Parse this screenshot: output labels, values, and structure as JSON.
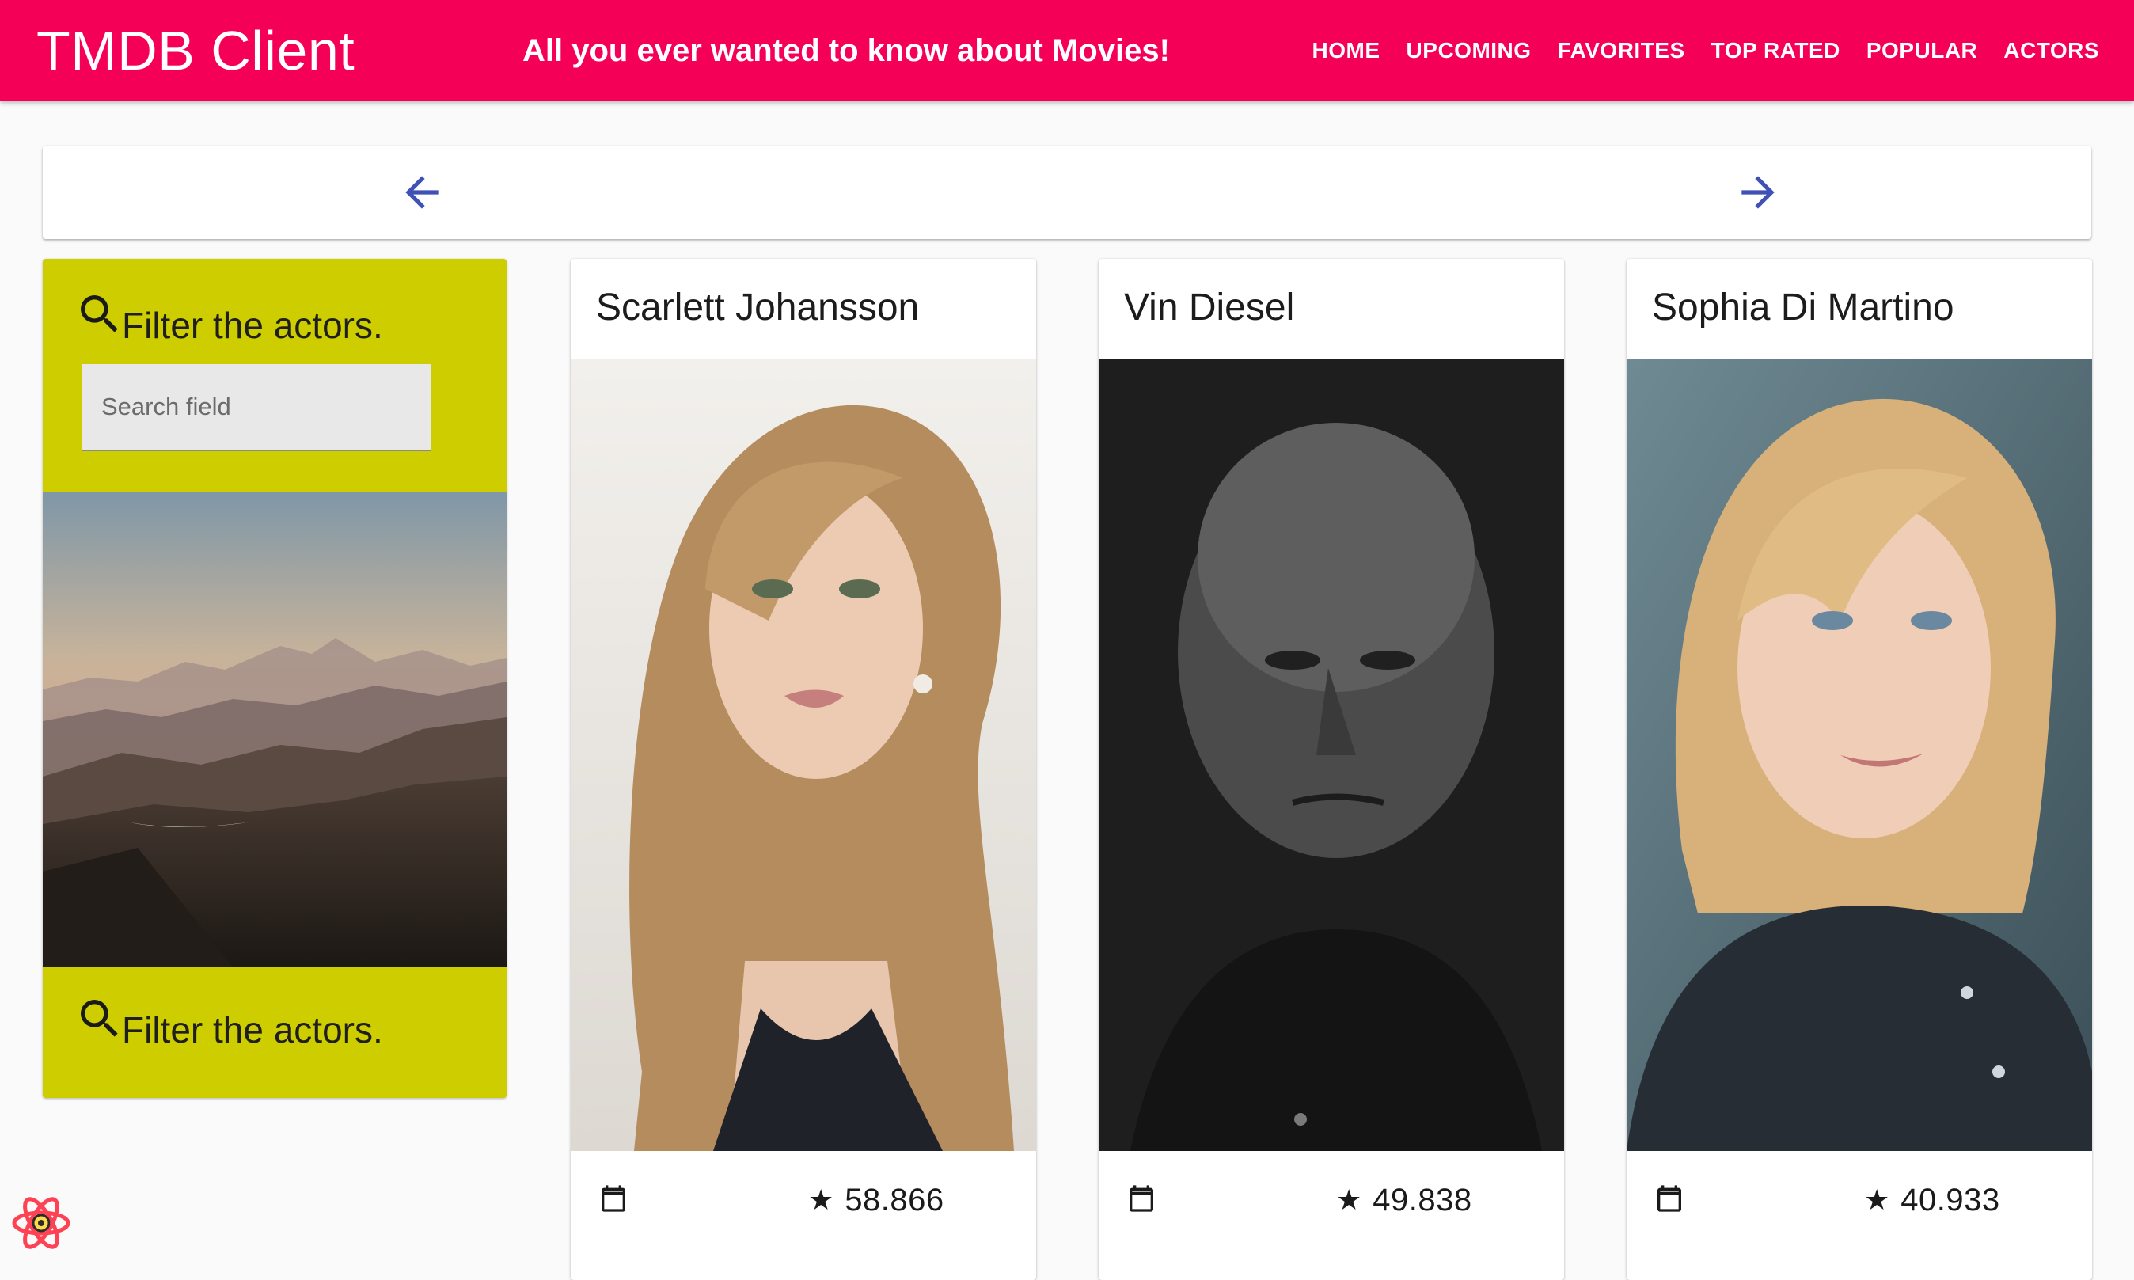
{
  "header": {
    "brand": "TMDB Client",
    "tagline": "All you ever wanted to know about Movies!",
    "nav": [
      "HOME",
      "UPCOMING",
      "FAVORITES",
      "TOP RATED",
      "POPULAR",
      "ACTORS"
    ]
  },
  "pager": {
    "prev_icon": "arrow-back-icon",
    "next_icon": "arrow-forward-icon"
  },
  "filter": {
    "title": "Filter the actors.",
    "footer_title": "Filter the actors.",
    "search_placeholder": "Search field",
    "search_value": "",
    "icon": "search-icon"
  },
  "actors": [
    {
      "name": "Scarlett Johansson",
      "rating": "58.866"
    },
    {
      "name": "Vin Diesel",
      "rating": "49.838"
    },
    {
      "name": "Sophia Di Martino",
      "rating": "40.933"
    }
  ],
  "colors": {
    "appbar": "#f50057",
    "filter_card": "#cdcd00",
    "pager_arrows": "#3f51b5"
  }
}
